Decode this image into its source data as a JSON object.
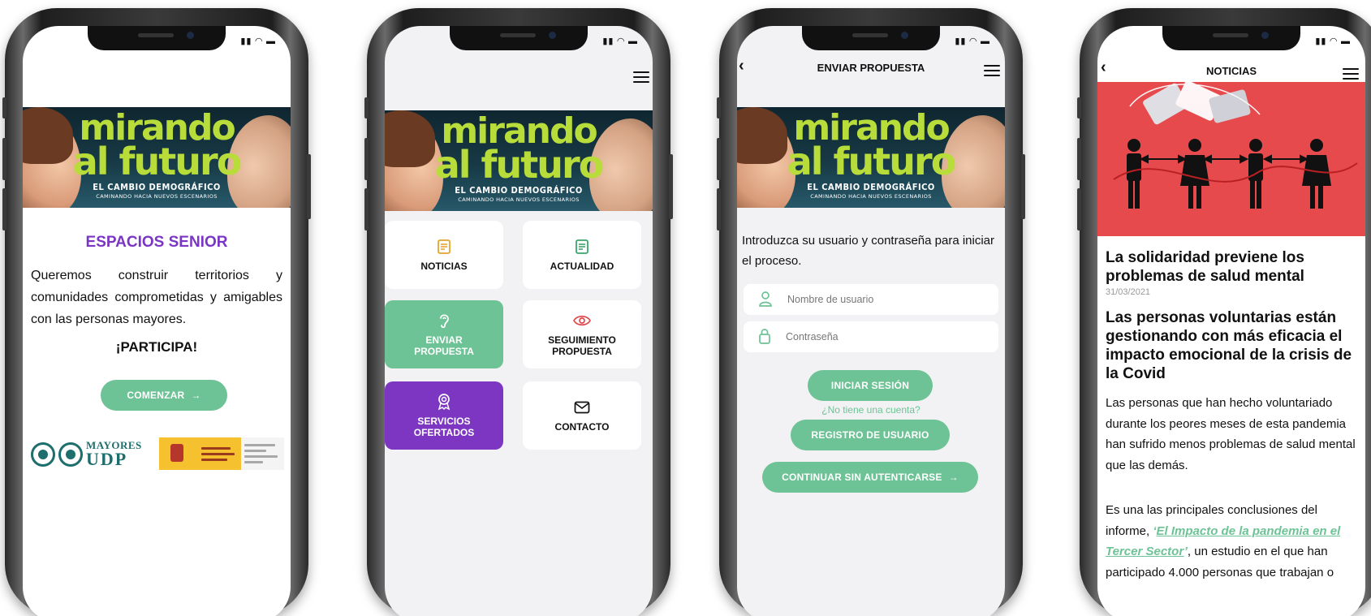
{
  "brand": {
    "banner_title_1": "mirando",
    "banner_title_2": "al futuro",
    "banner_subtitle": "EL CAMBIO DEMOGRÁFICO",
    "banner_tagline": "CAMINANDO HACIA NUEVOS ESCENARIOS",
    "accent_green": "#6dc395",
    "accent_purple": "#7d36c2"
  },
  "screen1": {
    "title": "ESPACIOS SENIOR",
    "body": "Queremos construir territorios y comunidades comprometidas y amigables con las personas mayores.",
    "cta": "¡PARTICIPA!",
    "start_button": "COMENZAR",
    "logo_udp_top": "MAYORES",
    "logo_udp_bottom": "UDP"
  },
  "screen2": {
    "tiles": [
      {
        "label": "NOTICIAS",
        "icon": "newspaper-icon"
      },
      {
        "label": "ACTUALIDAD",
        "icon": "newspaper-icon"
      },
      {
        "label": "ENVIAR PROPUESTA",
        "icon": "ear-icon"
      },
      {
        "label": "SEGUIMIENTO PROPUESTA",
        "icon": "eye-icon"
      },
      {
        "label": "SERVICIOS OFERTADOS",
        "icon": "award-icon"
      },
      {
        "label": "CONTACTO",
        "icon": "envelope-icon"
      }
    ]
  },
  "screen3": {
    "nav_title": "ENVIAR PROPUESTA",
    "intro": "Introduzca su usuario y contraseña para iniciar el proceso.",
    "username_placeholder": "Nombre de usuario",
    "password_placeholder": "Contraseña",
    "login_button": "INICIAR SESIÓN",
    "no_account": "¿No tiene una cuenta?",
    "register_button": "REGISTRO DE USUARIO",
    "continue_button": "CONTINUAR SIN AUTENTICARSE"
  },
  "screen4": {
    "nav_title": "NOTICIAS",
    "headline": "La solidaridad previene los problemas de salud mental",
    "date": "31/03/2021",
    "subheadline": "Las personas voluntarias están gestionando con más eficacia el impacto emocional de la crisis de la Covid",
    "paragraph1": "Las personas que han hecho voluntariado durante los peores meses de esta pandemia han sufrido menos problemas de salud mental que las demás.",
    "paragraph2_start": "Es una las principales conclusiones del informe, ",
    "paragraph2_quote_open": "‘",
    "paragraph2_link": "El Impacto de la pandemia en el Tercer Sector",
    "paragraph2_quote_close": "’",
    "paragraph2_end": ", un estudio en el que han participado 4.000 personas que trabajan o"
  }
}
